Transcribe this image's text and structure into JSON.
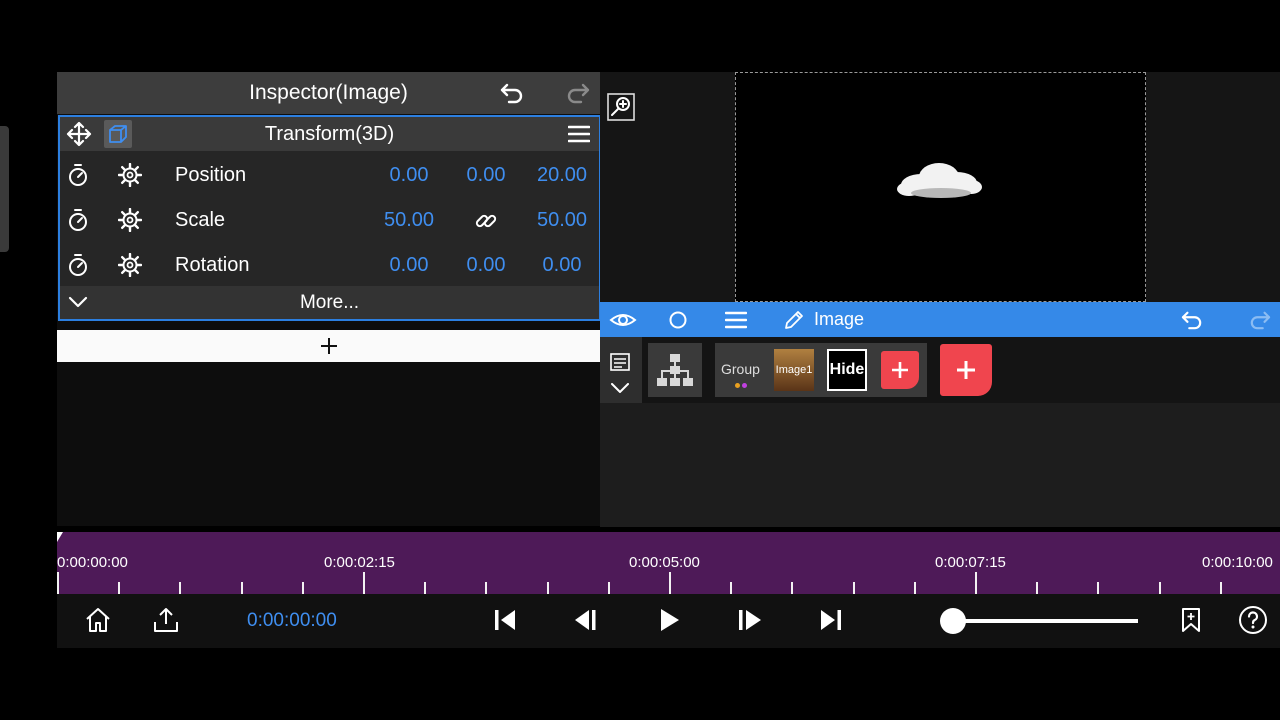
{
  "inspector": {
    "title": "Inspector(Image)",
    "transform_title": "Transform(3D)",
    "more_label": "More...",
    "rows": [
      {
        "label": "Position",
        "v1": "0.00",
        "v2": "0.00",
        "v3": "20.00"
      },
      {
        "label": "Scale",
        "v1": "50.00",
        "v3": "50.00"
      },
      {
        "label": "Rotation",
        "v1": "0.00",
        "v2": "0.00",
        "v3": "0.00"
      }
    ]
  },
  "layers": {
    "toolbar_label": "Image",
    "group_label": "Group",
    "image1_label": "Image1",
    "hide_label": "Hide"
  },
  "timeline": {
    "labels": [
      "0:00:00:00",
      "0:00:02:15",
      "0:00:05:00",
      "0:00:07:15",
      "0:00:10:00"
    ]
  },
  "transport": {
    "timecode": "0:00:00:00"
  },
  "colors": {
    "accent": "#3589e8",
    "value_blue": "#3f8ef0",
    "timeline": "#4e1a58",
    "add_red": "#f0454e"
  },
  "icons": {
    "inspector": [
      "undo-icon",
      "redo-icon",
      "move-icon",
      "cube-icon",
      "menu-icon",
      "stopwatch-icon",
      "gear-icon",
      "link-icon",
      "chevron-down-icon",
      "plus-icon"
    ],
    "preview": [
      "zoom-icon"
    ],
    "layers": [
      "eye-icon",
      "circle-icon",
      "menu-icon",
      "pencil-icon",
      "list-icon",
      "hierarchy-icon",
      "plus-icon"
    ],
    "transport": [
      "home-icon",
      "share-icon",
      "skip-start-icon",
      "step-back-icon",
      "play-icon",
      "step-forward-icon",
      "skip-end-icon",
      "bookmark-icon",
      "help-icon"
    ]
  }
}
